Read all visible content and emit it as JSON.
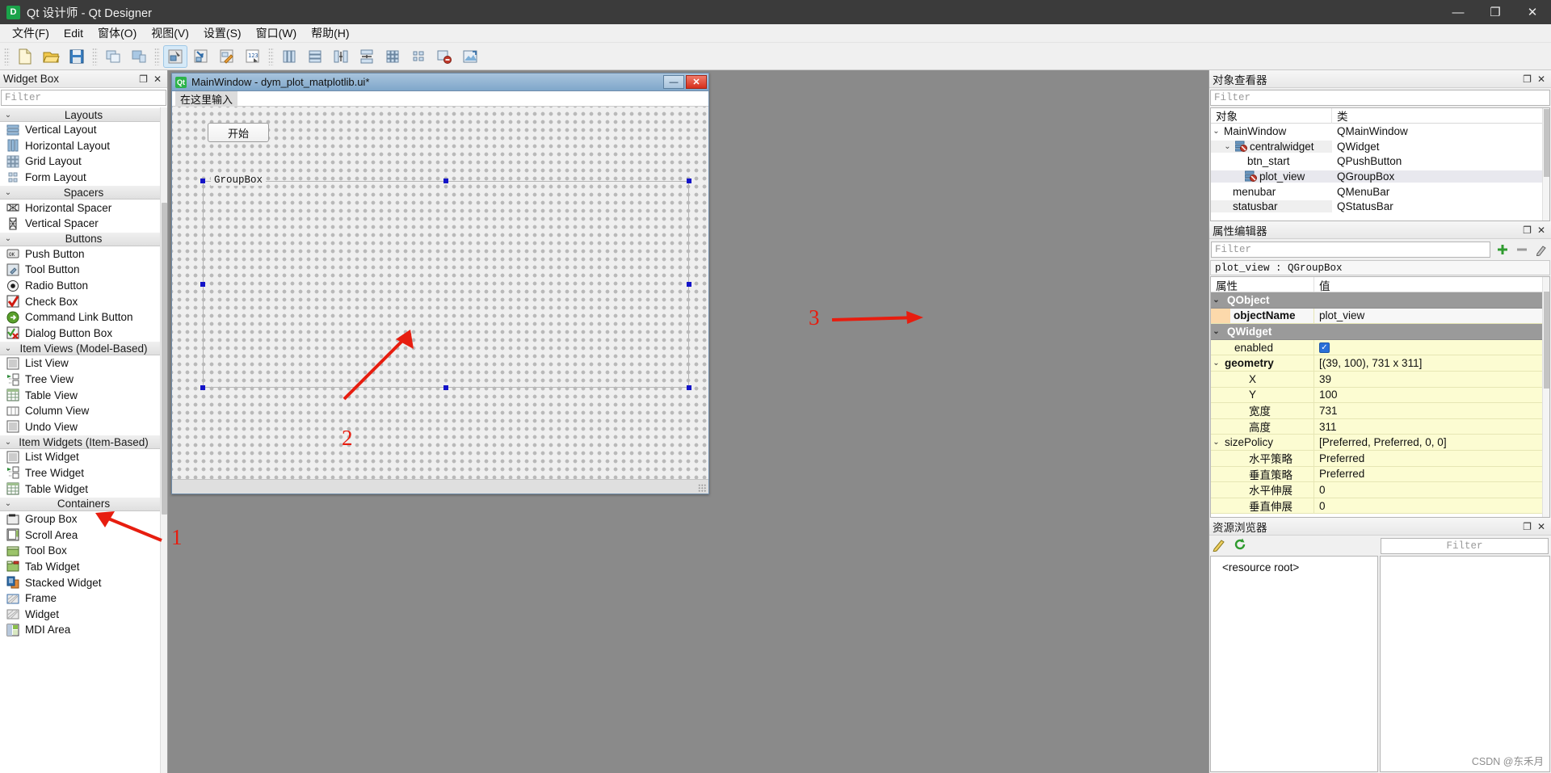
{
  "titlebar": {
    "app_badge": "D",
    "title": "Qt 设计师 - Qt Designer",
    "minimize": "—",
    "maximize": "❐",
    "close": "✕"
  },
  "menubar": {
    "items": [
      "文件(F)",
      "Edit",
      "窗体(O)",
      "视图(V)",
      "设置(S)",
      "窗口(W)",
      "帮助(H)"
    ]
  },
  "toolbar": {
    "groups": [
      {
        "buttons": [
          {
            "name": "new-form-icon",
            "label": "New"
          },
          {
            "name": "open-form-icon",
            "label": "Open"
          },
          {
            "name": "save-form-icon",
            "label": "Save"
          }
        ]
      },
      {
        "buttons": [
          {
            "name": "undo-icon",
            "label": "Undo"
          },
          {
            "name": "redo-icon",
            "label": "Redo"
          }
        ]
      },
      {
        "buttons": [
          {
            "name": "edit-widgets-icon",
            "label": "Edit Widgets",
            "active": true
          },
          {
            "name": "edit-signals-slots-icon",
            "label": "Edit Signals/Slots"
          },
          {
            "name": "edit-buddies-icon",
            "label": "Edit Buddies"
          },
          {
            "name": "edit-tab-order-icon",
            "label": "Edit Tab Order"
          }
        ]
      },
      {
        "buttons": [
          {
            "name": "layout-horizontally-icon",
            "label": "Lay Out Horizontally"
          },
          {
            "name": "layout-vertically-icon",
            "label": "Lay Out Vertically"
          },
          {
            "name": "layout-splitter-horizontal-icon",
            "label": "Lay Out in a Splitter Horizontally"
          },
          {
            "name": "layout-splitter-vertical-icon",
            "label": "Lay Out in a Splitter Vertically"
          },
          {
            "name": "layout-grid-icon",
            "label": "Lay Out in a Grid"
          },
          {
            "name": "layout-form-icon",
            "label": "Lay Out in a Form Layout"
          },
          {
            "name": "break-layout-icon",
            "label": "Break Layout"
          },
          {
            "name": "adjust-size-icon",
            "label": "Adjust Size"
          }
        ]
      }
    ]
  },
  "widget_box": {
    "dock_title": "Widget Box",
    "float_btn": "❐",
    "close_btn": "✕",
    "filter_placeholder": "Filter",
    "groups": [
      {
        "name": "Layouts",
        "collapsed_glyph": "⌄",
        "items": [
          {
            "label": "Vertical Layout",
            "icon": "vertical-layout-icon"
          },
          {
            "label": "Horizontal Layout",
            "icon": "horizontal-layout-icon"
          },
          {
            "label": "Grid Layout",
            "icon": "grid-layout-icon"
          },
          {
            "label": "Form Layout",
            "icon": "form-layout-icon"
          }
        ]
      },
      {
        "name": "Spacers",
        "collapsed_glyph": "⌄",
        "items": [
          {
            "label": "Horizontal Spacer",
            "icon": "horizontal-spacer-icon"
          },
          {
            "label": "Vertical Spacer",
            "icon": "vertical-spacer-icon"
          }
        ]
      },
      {
        "name": "Buttons",
        "collapsed_glyph": "⌄",
        "items": [
          {
            "label": "Push Button",
            "icon": "push-button-icon"
          },
          {
            "label": "Tool Button",
            "icon": "tool-button-icon"
          },
          {
            "label": "Radio Button",
            "icon": "radio-button-icon"
          },
          {
            "label": "Check Box",
            "icon": "check-box-icon"
          },
          {
            "label": "Command Link Button",
            "icon": "command-link-button-icon"
          },
          {
            "label": "Dialog Button Box",
            "icon": "dialog-button-box-icon"
          }
        ]
      },
      {
        "name": "Item Views (Model-Based)",
        "collapsed_glyph": "⌄",
        "items": [
          {
            "label": "List View",
            "icon": "list-view-icon"
          },
          {
            "label": "Tree View",
            "icon": "tree-view-icon"
          },
          {
            "label": "Table View",
            "icon": "table-view-icon"
          },
          {
            "label": "Column View",
            "icon": "column-view-icon"
          },
          {
            "label": "Undo View",
            "icon": "undo-view-icon"
          }
        ]
      },
      {
        "name": "Item Widgets (Item-Based)",
        "collapsed_glyph": "⌄",
        "items": [
          {
            "label": "List Widget",
            "icon": "list-widget-icon"
          },
          {
            "label": "Tree Widget",
            "icon": "tree-widget-icon"
          },
          {
            "label": "Table Widget",
            "icon": "table-widget-icon"
          }
        ]
      },
      {
        "name": "Containers",
        "collapsed_glyph": "⌄",
        "items": [
          {
            "label": "Group Box",
            "icon": "group-box-icon"
          },
          {
            "label": "Scroll Area",
            "icon": "scroll-area-icon"
          },
          {
            "label": "Tool Box",
            "icon": "tool-box-icon"
          },
          {
            "label": "Tab Widget",
            "icon": "tab-widget-icon"
          },
          {
            "label": "Stacked Widget",
            "icon": "stacked-widget-icon"
          },
          {
            "label": "Frame",
            "icon": "frame-icon"
          },
          {
            "label": "Widget",
            "icon": "widget-icon"
          },
          {
            "label": "MDI Area",
            "icon": "mdi-area-icon"
          }
        ]
      }
    ]
  },
  "form_window": {
    "badge": "Qt",
    "title": "MainWindow - dym_plot_matplotlib.ui*",
    "minimize": "—",
    "close": "✕",
    "menu_placeholder": "在这里输入",
    "start_button": "开始",
    "groupbox_title": "GroupBox"
  },
  "annotations": [
    {
      "number": "1"
    },
    {
      "number": "2"
    },
    {
      "number": "3"
    }
  ],
  "object_inspector": {
    "dock_title": "对象查看器",
    "float_btn": "❐",
    "close_btn": "✕",
    "filter_placeholder": "Filter",
    "columns": [
      "对象",
      "类"
    ],
    "rows": [
      {
        "name": "MainWindow",
        "class": "QMainWindow",
        "indent": 0,
        "twisty": "⌄",
        "icon": "",
        "selected": false
      },
      {
        "name": "centralwidget",
        "class": "QWidget",
        "indent": 1,
        "twisty": "⌄",
        "icon": "no-layout-icon",
        "selected": false,
        "highlight": true
      },
      {
        "name": "btn_start",
        "class": "QPushButton",
        "indent": 2,
        "twisty": "",
        "icon": "",
        "selected": false
      },
      {
        "name": "plot_view",
        "class": "QGroupBox",
        "indent": 2,
        "twisty": "",
        "icon": "no-layout-icon",
        "selected": true
      },
      {
        "name": "menubar",
        "class": "QMenuBar",
        "indent": 1,
        "twisty": "",
        "icon": "",
        "selected": false
      },
      {
        "name": "statusbar",
        "class": "QStatusBar",
        "indent": 1,
        "twisty": "",
        "icon": "",
        "selected": false
      }
    ]
  },
  "property_editor": {
    "dock_title": "属性编辑器",
    "float_btn": "❐",
    "close_btn": "✕",
    "filter_placeholder": "Filter",
    "add_btn": "+",
    "remove_btn": "−",
    "config_btn": "✐",
    "object_line": "plot_view : QGroupBox",
    "columns": [
      "属性",
      "值"
    ],
    "rows": [
      {
        "kind": "group",
        "key": "QObject",
        "value": "",
        "twisty": "⌄"
      },
      {
        "kind": "objname",
        "key": "objectName",
        "value": "plot_view",
        "bold": true,
        "swatch": true,
        "dots": "•"
      },
      {
        "kind": "group",
        "key": "QWidget",
        "value": "",
        "twisty": "⌄"
      },
      {
        "kind": "prop",
        "key": "enabled",
        "value": "",
        "checkbox": true,
        "level": 1
      },
      {
        "kind": "prop",
        "key": "geometry",
        "value": "[(39, 100), 731 x 311]",
        "bold": true,
        "twisty": "⌄"
      },
      {
        "kind": "prop",
        "key": "X",
        "value": "39",
        "level": 2
      },
      {
        "kind": "prop",
        "key": "Y",
        "value": "100",
        "level": 2
      },
      {
        "kind": "prop",
        "key": "宽度",
        "value": "731",
        "level": 2
      },
      {
        "kind": "prop",
        "key": "高度",
        "value": "311",
        "level": 2
      },
      {
        "kind": "prop",
        "key": "sizePolicy",
        "value": "[Preferred, Preferred, 0, 0]",
        "twisty": "⌄"
      },
      {
        "kind": "prop",
        "key": "水平策略",
        "value": "Preferred",
        "level": 2
      },
      {
        "kind": "prop",
        "key": "垂直策略",
        "value": "Preferred",
        "level": 2
      },
      {
        "kind": "prop",
        "key": "水平伸展",
        "value": "0",
        "level": 2
      },
      {
        "kind": "prop",
        "key": "垂直伸展",
        "value": "0",
        "level": 2
      }
    ]
  },
  "resource_browser": {
    "dock_title": "资源浏览器",
    "float_btn": "❐",
    "close_btn": "✕",
    "edit_icon": "pencil-icon",
    "reload_icon": "reload-icon",
    "filter_placeholder": "Filter",
    "root_label": "<resource root>"
  },
  "watermark": "CSDN @东禾月",
  "colors": {
    "accent_red": "#e71d0f",
    "selection_blue": "#1414c8",
    "titlebar_bg": "#3b3b3b",
    "workspace_bg": "#8a8a8a",
    "property_yellow": "#fcfcd2",
    "group_gray": "#9a9a9a"
  }
}
